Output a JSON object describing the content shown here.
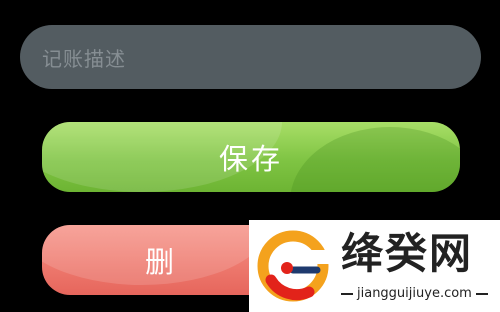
{
  "form": {
    "description_placeholder": "记账描述",
    "save_label": "保存",
    "delete_label": "删"
  },
  "watermark": {
    "brand": "绛癸网",
    "url": "jiangguijiuye.com"
  },
  "colors": {
    "background": "#000000",
    "input_bg": "#535c61",
    "save_green": "#7fc443",
    "delete_red": "#ee7a6f"
  }
}
